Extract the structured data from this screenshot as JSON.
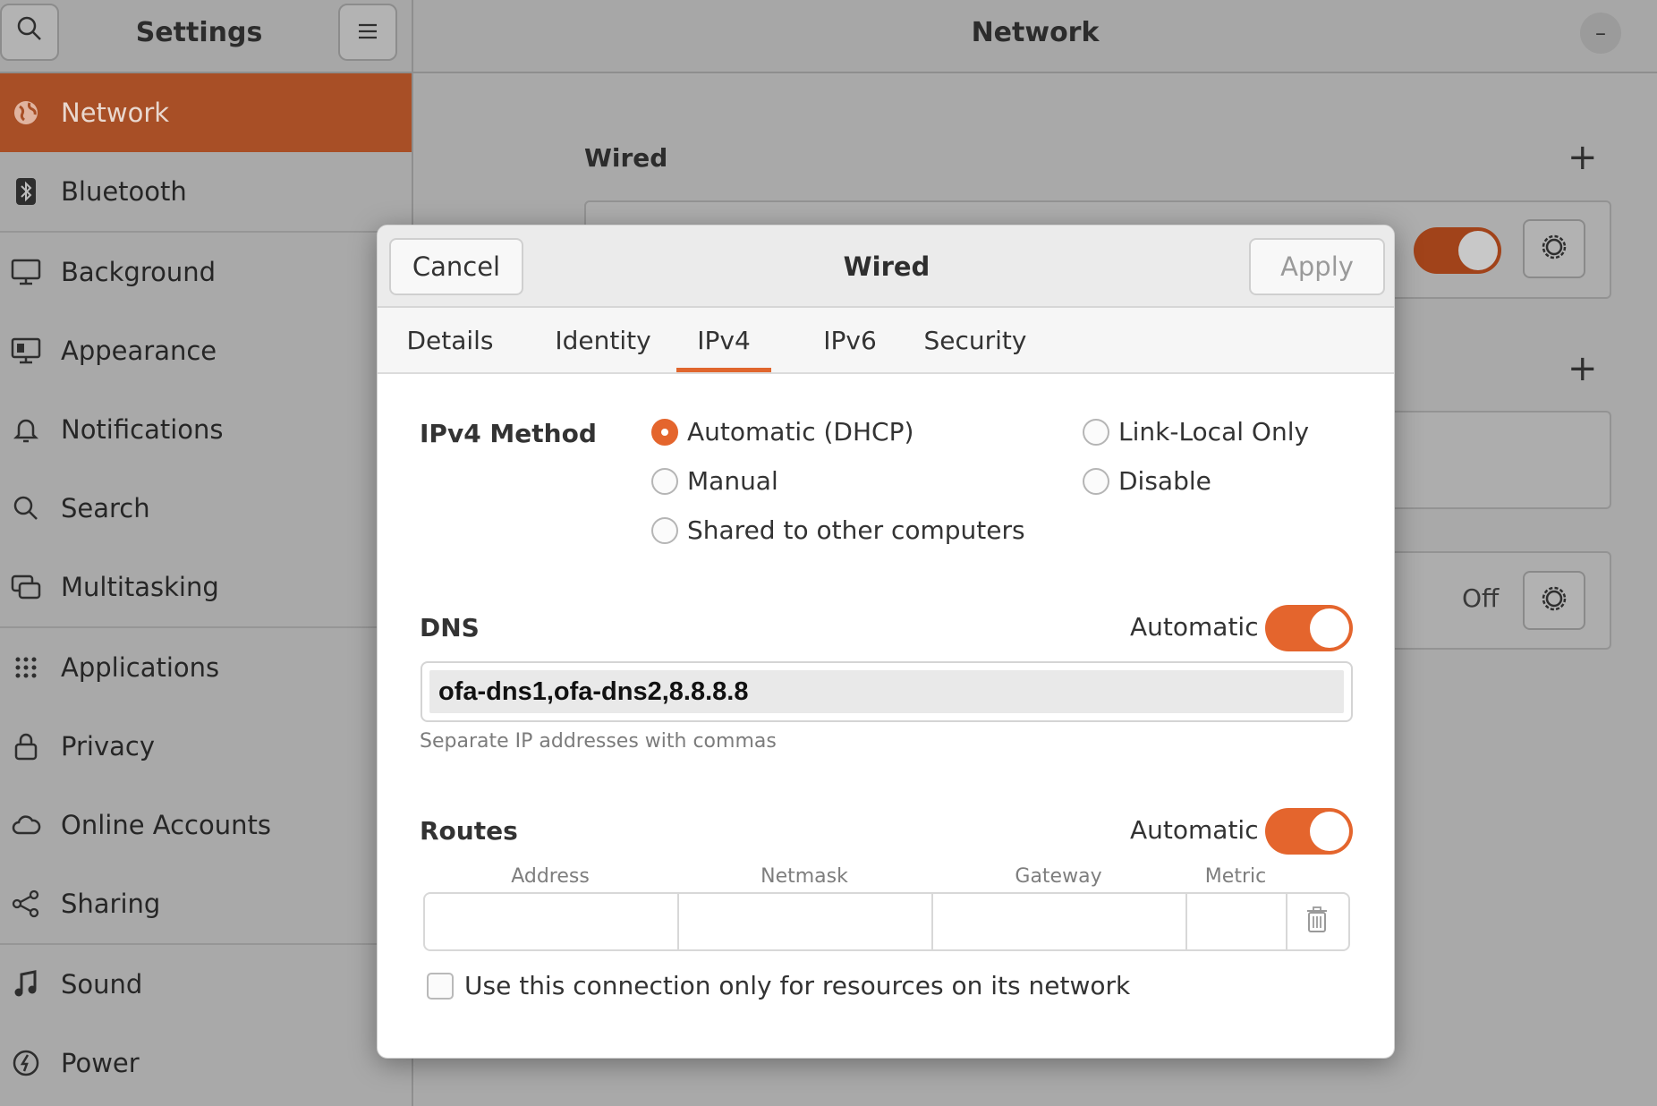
{
  "header": {
    "sidebar_title": "Settings",
    "panel_title": "Network",
    "search_icon": "search-icon",
    "menu_icon": "hamburger-menu-icon",
    "minimize_glyph": "–"
  },
  "sidebar": {
    "items": [
      {
        "label": "Network",
        "icon": "network-globe-icon",
        "active": true
      },
      {
        "label": "Bluetooth",
        "icon": "bluetooth-icon"
      },
      {
        "label": "Background",
        "icon": "monitor-icon"
      },
      {
        "label": "Appearance",
        "icon": "appearance-icon"
      },
      {
        "label": "Notifications",
        "icon": "bell-icon"
      },
      {
        "label": "Search",
        "icon": "search-icon"
      },
      {
        "label": "Multitasking",
        "icon": "multitasking-icon"
      },
      {
        "label": "Applications",
        "icon": "grid-icon",
        "chevron": "›"
      },
      {
        "label": "Privacy",
        "icon": "lock-icon",
        "chevron": "›"
      },
      {
        "label": "Online Accounts",
        "icon": "cloud-icon"
      },
      {
        "label": "Sharing",
        "icon": "share-icon"
      },
      {
        "label": "Sound",
        "icon": "music-note-icon"
      },
      {
        "label": "Power",
        "icon": "power-icon"
      }
    ]
  },
  "content": {
    "wired_label": "Wired",
    "plus_glyph": "+",
    "off_label": "Off"
  },
  "dialog": {
    "cancel_label": "Cancel",
    "title": "Wired",
    "apply_label": "Apply",
    "tabs": [
      {
        "label": "Details"
      },
      {
        "label": "Identity"
      },
      {
        "label": "IPv4",
        "active": true
      },
      {
        "label": "IPv6"
      },
      {
        "label": "Security"
      }
    ],
    "ipv4_method": {
      "label": "IPv4 Method",
      "options": [
        {
          "label": "Automatic (DHCP)",
          "checked": true
        },
        {
          "label": "Manual",
          "checked": false
        },
        {
          "label": "Shared to other computers",
          "checked": false
        },
        {
          "label": "Link-Local Only",
          "checked": false
        },
        {
          "label": "Disable",
          "checked": false
        }
      ]
    },
    "dns": {
      "label": "DNS",
      "automatic_label": "Automatic",
      "automatic_on": true,
      "value": "ofa-dns1,ofa-dns2,8.8.8.8",
      "hint": "Separate IP addresses with commas"
    },
    "routes": {
      "label": "Routes",
      "automatic_label": "Automatic",
      "automatic_on": true,
      "columns": [
        "Address",
        "Netmask",
        "Gateway",
        "Metric"
      ]
    },
    "only_local": {
      "label": "Use this connection only for resources on its network",
      "checked": false
    }
  },
  "colors": {
    "accent": "#e4652d",
    "sidebar_active": "#a84f26"
  }
}
